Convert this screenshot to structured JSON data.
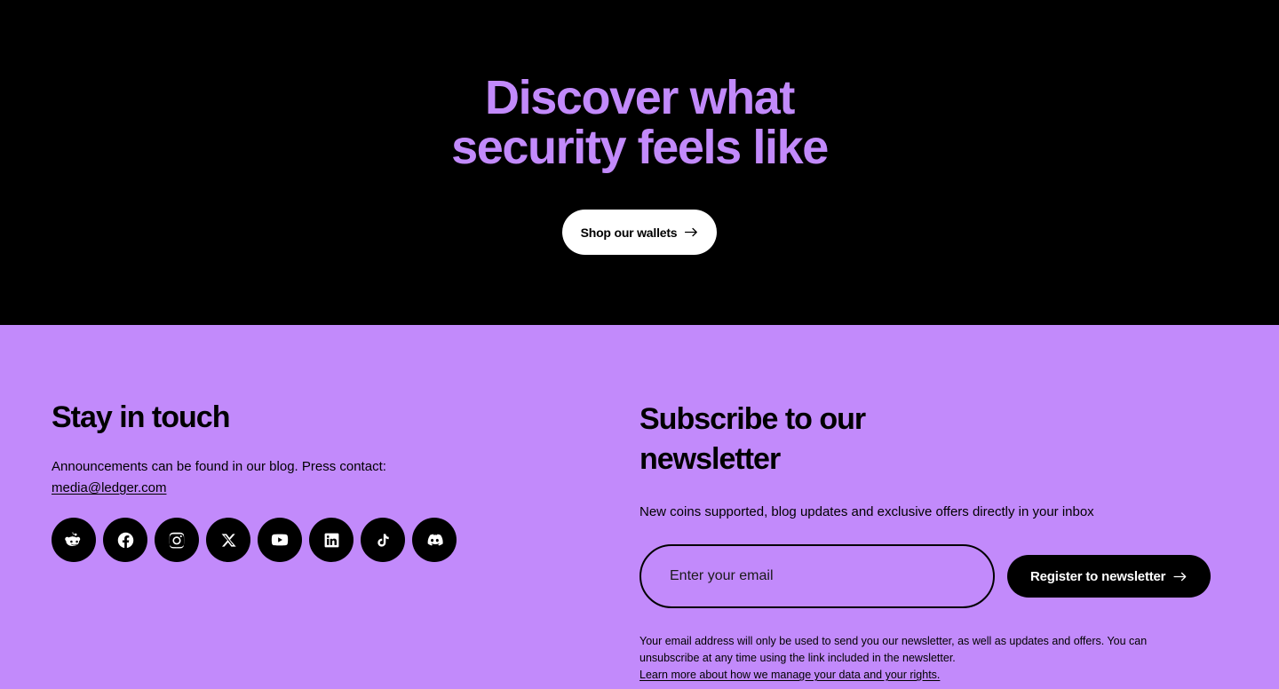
{
  "hero": {
    "title_line1": "Discover what",
    "title_line2": "security feels like",
    "cta_label": "Shop our wallets",
    "cta_icon": "arrow-right-icon",
    "background_color": "#000000",
    "title_color": "#C28AFB"
  },
  "footer": {
    "background_color": "#C28AFB",
    "text_color": "#000000",
    "stay_in_touch": {
      "title": "Stay in touch",
      "description": "Announcements can be found in our blog. Press contact:",
      "email": "media@ledger.com",
      "socials": [
        {
          "name": "reddit",
          "icon": "reddit-icon"
        },
        {
          "name": "facebook",
          "icon": "facebook-icon"
        },
        {
          "name": "instagram",
          "icon": "instagram-icon"
        },
        {
          "name": "x",
          "icon": "x-twitter-icon"
        },
        {
          "name": "youtube",
          "icon": "youtube-icon"
        },
        {
          "name": "linkedin",
          "icon": "linkedin-icon"
        },
        {
          "name": "tiktok",
          "icon": "tiktok-icon"
        },
        {
          "name": "discord",
          "icon": "discord-icon"
        }
      ]
    },
    "newsletter": {
      "title_line1": "Subscribe to our",
      "title_line2": "newsletter",
      "subtitle": "New coins supported, blog updates and exclusive offers directly in your inbox",
      "email_placeholder": "Enter your email",
      "email_value": "",
      "register_label": "Register to newsletter",
      "register_icon": "arrow-right-icon",
      "legal_text": "Your email address will only be used to send you our newsletter, as well as updates and offers. You can unsubscribe at any time using the link included in the newsletter.",
      "legal_link": "Learn more about how we manage your data and your rights."
    }
  }
}
